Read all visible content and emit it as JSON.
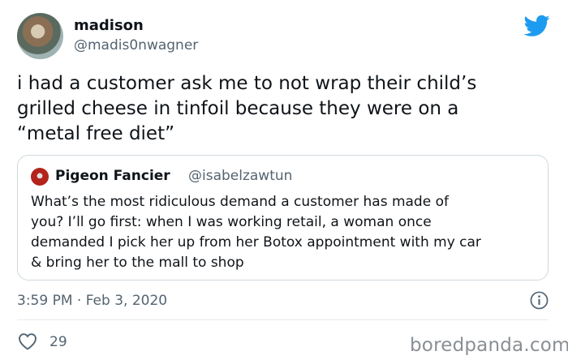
{
  "author": {
    "name": "madison",
    "handle": "@madis0nwagner"
  },
  "tweet": {
    "text": "i had a customer ask me to not wrap their child’s\ngrilled cheese in tinfoil because they were on a\n“metal free diet”"
  },
  "quoted_tweet": {
    "name": "Pigeon Fancier",
    "handle": "@isabelzawtun",
    "text": "What’s the most ridiculous demand a customer has made of\nyou? I’ll go first: when I was working retail, a woman once\ndemanded I pick her up from her Botox appointment with my car\n& bring her to the mall to shop"
  },
  "meta": {
    "timestamp": "3:59 PM · Feb 3, 2020",
    "like_count": "29"
  },
  "watermark": "boredpanda.com",
  "icons": {
    "brand": "twitter-bird-icon",
    "info": "info-icon",
    "like": "heart-icon"
  },
  "colors": {
    "twitter_blue": "#1d9bf0",
    "secondary_text": "#536471",
    "border": "#cfd9de"
  }
}
